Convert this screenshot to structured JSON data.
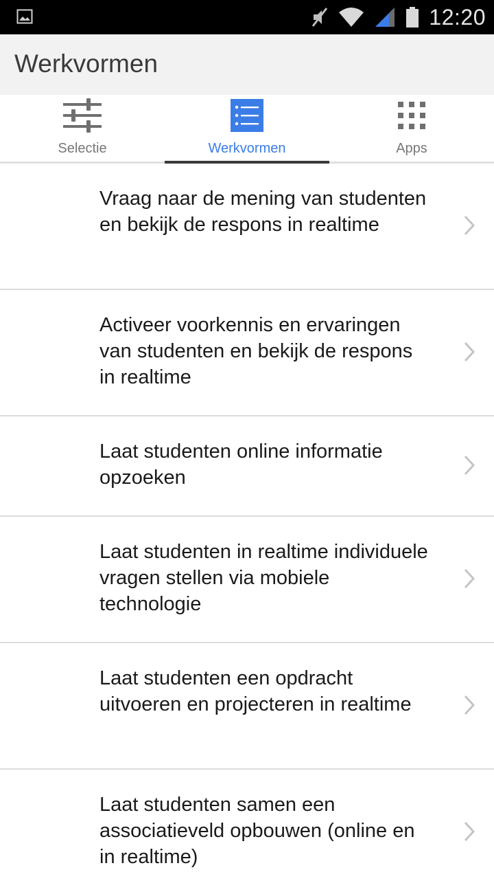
{
  "status_bar": {
    "time": "12:20",
    "icons": [
      "image-notification-icon",
      "muted-icon",
      "wifi-icon",
      "signal-icon",
      "battery-icon"
    ]
  },
  "app_bar": {
    "title": "Werkvormen"
  },
  "tabs": [
    {
      "label": "Selectie",
      "icon": "sliders-icon",
      "active": false
    },
    {
      "label": "Werkvormen",
      "icon": "list-icon",
      "active": true
    },
    {
      "label": "Apps",
      "icon": "grid-icon",
      "active": false
    }
  ],
  "colors": {
    "accent": "#3b7de6",
    "status_bar": "#000000",
    "app_bar": "#f2f2f2"
  },
  "items": [
    {
      "label": "Vraag naar de mening van studenten en bekijk de respons in realtime"
    },
    {
      "label": "Activeer voorkennis en ervaringen van studenten en bekijk de respons in realtime"
    },
    {
      "label": "Laat studenten online informatie opzoeken"
    },
    {
      "label": "Laat studenten in realtime individuele vragen stellen via mobiele technologie"
    },
    {
      "label": "Laat studenten een opdracht uitvoeren en projecteren in realtime"
    },
    {
      "label": "Laat studenten samen een associatieveld opbouwen (online en in realtime)"
    }
  ]
}
